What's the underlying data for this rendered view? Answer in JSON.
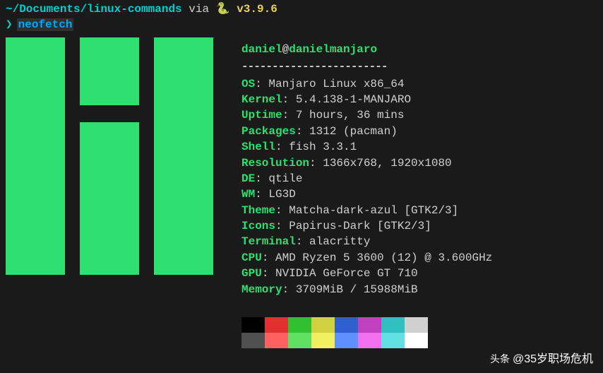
{
  "prompt": {
    "path": "~/Documents/linux-commands",
    "via": "via",
    "snake": "🐍",
    "version": "v3.9.6",
    "arrow": "❯",
    "command": "neofetch"
  },
  "userhost": {
    "user": "daniel",
    "at": "@",
    "host": "danielmanjaro"
  },
  "separator": "------------------------",
  "info": [
    {
      "key": "OS",
      "val": ": Manjaro Linux x86_64"
    },
    {
      "key": "Kernel",
      "val": ": 5.4.138-1-MANJARO"
    },
    {
      "key": "Uptime",
      "val": ": 7 hours, 36 mins"
    },
    {
      "key": "Packages",
      "val": ": 1312 (pacman)"
    },
    {
      "key": "Shell",
      "val": ": fish 3.3.1"
    },
    {
      "key": "Resolution",
      "val": ": 1366x768, 1920x1080"
    },
    {
      "key": "DE",
      "val": ": qtile"
    },
    {
      "key": "WM",
      "val": ": LG3D"
    },
    {
      "key": "Theme",
      "val": ": Matcha-dark-azul [GTK2/3]"
    },
    {
      "key": "Icons",
      "val": ": Papirus-Dark [GTK2/3]"
    },
    {
      "key": "Terminal",
      "val": ": alacritty"
    },
    {
      "key": "CPU",
      "val": ": AMD Ryzen 5 3600 (12) @ 3.600GHz"
    },
    {
      "key": "GPU",
      "val": ": NVIDIA GeForce GT 710"
    },
    {
      "key": "Memory",
      "val": ": 3709MiB / 15988MiB"
    }
  ],
  "palette": {
    "row1": [
      "#000000",
      "#e03030",
      "#30c030",
      "#d0d040",
      "#3060d0",
      "#c040c0",
      "#30c0c0",
      "#d0d0d0"
    ],
    "row2": [
      "#505050",
      "#ff6060",
      "#60e060",
      "#f0f060",
      "#6090ff",
      "#f070f0",
      "#60e0e0",
      "#ffffff"
    ]
  },
  "logo_cells": [
    "g",
    "g",
    "g",
    "g",
    "",
    "g",
    "g",
    "g",
    "g",
    "",
    "g",
    "g",
    "g",
    "g",
    "g",
    "g",
    "g",
    "g",
    "",
    "g",
    "g",
    "g",
    "g",
    "",
    "g",
    "g",
    "g",
    "g",
    "g",
    "g",
    "g",
    "g",
    "",
    "g",
    "g",
    "g",
    "g",
    "",
    "g",
    "g",
    "g",
    "g",
    "g",
    "g",
    "g",
    "g",
    "",
    "g",
    "g",
    "g",
    "g",
    "",
    "g",
    "g",
    "g",
    "g",
    "g",
    "g",
    "g",
    "g",
    "",
    "",
    "",
    "",
    "",
    "",
    "g",
    "g",
    "g",
    "g",
    "g",
    "g",
    "g",
    "g",
    "",
    "g",
    "g",
    "g",
    "g",
    "",
    "g",
    "g",
    "g",
    "g",
    "g",
    "g",
    "g",
    "g",
    "",
    "g",
    "g",
    "g",
    "g",
    "",
    "g",
    "g",
    "g",
    "g",
    "g",
    "g",
    "g",
    "g",
    "",
    "g",
    "g",
    "g",
    "g",
    "",
    "g",
    "g",
    "g",
    "g",
    "g",
    "g",
    "g",
    "g",
    "",
    "g",
    "g",
    "g",
    "g",
    "",
    "g",
    "g",
    "g",
    "g",
    "g",
    "g",
    "g",
    "g",
    "",
    "g",
    "g",
    "g",
    "g",
    "",
    "g",
    "g",
    "g",
    "g",
    "g",
    "g",
    "g",
    "g",
    "",
    "g",
    "g",
    "g",
    "g",
    "",
    "g",
    "g",
    "g",
    "g",
    "g",
    "g",
    "g",
    "g",
    "",
    "g",
    "g",
    "g",
    "g",
    "",
    "g",
    "g",
    "g",
    "g",
    "g",
    "g",
    "g",
    "g",
    "",
    "g",
    "g",
    "g",
    "g",
    "",
    "g",
    "g",
    "g",
    "g",
    "g",
    "g",
    "g",
    "g",
    "",
    "g",
    "g",
    "g",
    "g",
    "",
    "g",
    "g",
    "g",
    "g"
  ],
  "watermark": {
    "prefix": "头条",
    "text": "@35岁职场危机"
  }
}
